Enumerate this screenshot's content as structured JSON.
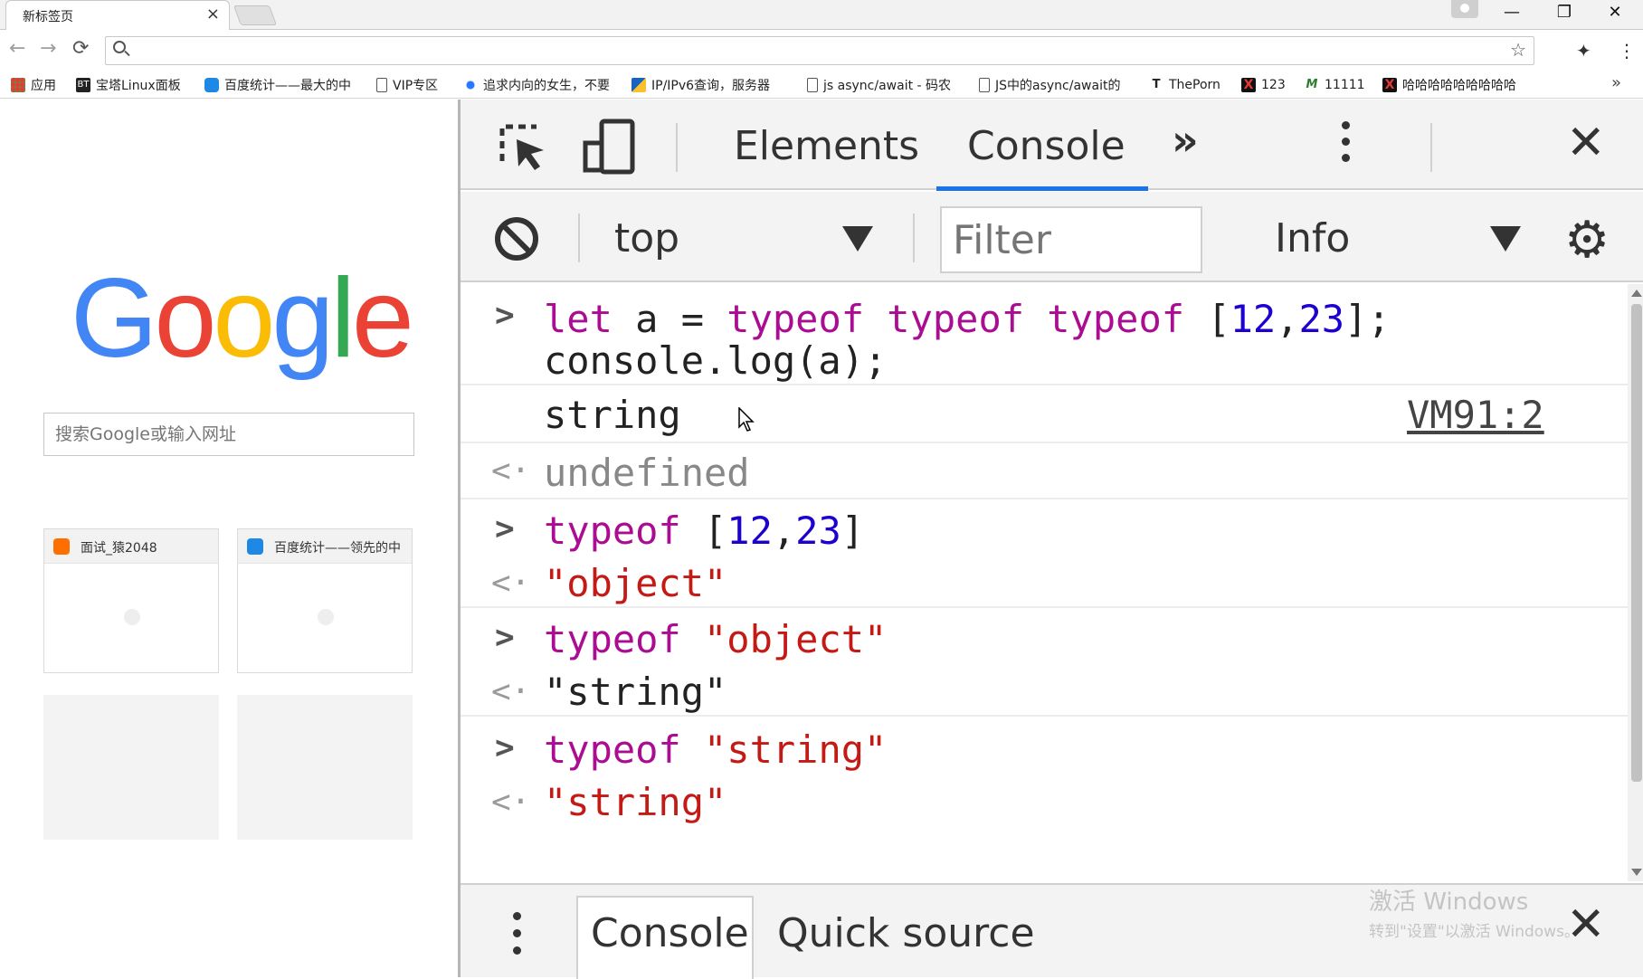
{
  "tab": {
    "title": "新标签页",
    "close": "×"
  },
  "window_controls": {
    "minimize": "—",
    "restore": "❐",
    "close": "✕"
  },
  "toolbar": {
    "back": "←",
    "forward": "→",
    "reload": "⟳",
    "star": "☆",
    "extension": "✦",
    "menu": "⋮"
  },
  "omnibox": {
    "value": "",
    "placeholder": ""
  },
  "bookmarks": [
    {
      "label": "应用",
      "icon": "apps-icon",
      "color": "#e53935"
    },
    {
      "label": "宝塔Linux面板",
      "icon": "bt-icon",
      "color": "#222222"
    },
    {
      "label": "百度统计——最大的中",
      "icon": "baidu-tongji-icon",
      "color": "#1e88e5"
    },
    {
      "label": "VIP专区",
      "icon": "page-icon",
      "color": "#ffffff"
    },
    {
      "label": "追求内向的女生，不要",
      "icon": "baidu-paw-icon",
      "color": "#2979ff"
    },
    {
      "label": "IP/IPv6查询，服务器",
      "icon": "ip-icon",
      "color": "#1565c0"
    },
    {
      "label": "js async/await - 码农",
      "icon": "page-icon",
      "color": "#ffffff"
    },
    {
      "label": "JS中的async/await的",
      "icon": "page-icon",
      "color": "#ffffff"
    },
    {
      "label": "ThePorn",
      "icon": "t-icon",
      "color": "#ffffff"
    },
    {
      "label": "123",
      "icon": "x-red-icon",
      "color": "#111111"
    },
    {
      "label": "11111",
      "icon": "m-icon",
      "color": "#ffffff"
    },
    {
      "label": "哈哈哈哈哈哈哈哈哈",
      "icon": "x-red-icon",
      "color": "#111111"
    }
  ],
  "bookmarks_more": "»",
  "ntp": {
    "logo": [
      "G",
      "o",
      "o",
      "g",
      "l",
      "e"
    ],
    "search_placeholder": "搜索Google或输入网址",
    "tiles": [
      {
        "title": "面试_猿2048",
        "icon_color": "#ff6f00"
      },
      {
        "title": "百度统计——领先的中",
        "icon_color": "#1e88e5"
      }
    ]
  },
  "devtools": {
    "tabs": {
      "elements": "Elements",
      "console": "Console",
      "more": "»"
    },
    "close": "✕",
    "context": "top",
    "filter_placeholder": "Filter",
    "level": "Info",
    "gear": "⚙",
    "messages": {
      "m1_line1": {
        "kw1": "let",
        "plain1": " a = ",
        "kw2": "typeof typeof typeof",
        "plain2": " [",
        "n1": "12",
        "comma": ",",
        "n2": "23",
        "plain3": "];"
      },
      "m1_line2": "console.log(a);",
      "m2_output": "string",
      "m2_source": "VM91:2",
      "m3_result": "undefined",
      "m4_input": {
        "kw": "typeof",
        "plain1": " [",
        "n1": "12",
        "comma": ",",
        "n2": "23",
        "plain2": "]"
      },
      "m5_result": "\"object\"",
      "m6_input": {
        "kw": "typeof",
        "str": "\"object\""
      },
      "m7_result": "\"string\"",
      "m8_input": {
        "kw": "typeof",
        "str": "\"string\""
      },
      "m9_result": "\"string\""
    },
    "drawer": {
      "console": "Console",
      "quick_source": "Quick source",
      "close": "✕"
    },
    "watermark": {
      "line1": "激活 Windows",
      "line2": "转到\"设置\"以激活 Windows。"
    }
  },
  "colors": {
    "accent": "#1a73e8",
    "keyword": "#aa0d91",
    "number": "#1c00cf",
    "string": "#c41a16"
  }
}
